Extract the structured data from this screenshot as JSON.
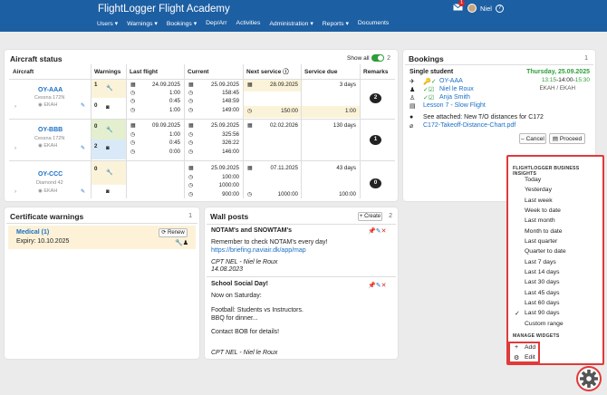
{
  "app": {
    "title": "FlightLogger Flight Academy",
    "notification_count": "1",
    "user": "Niel",
    "help": "?"
  },
  "nav": [
    "Users",
    "Warnings",
    "Bookings",
    "Dep/Arr",
    "Activities",
    "Administration",
    "Reports",
    "Documents"
  ],
  "aircraft": {
    "title": "Aircraft status",
    "show_all_label": "Show all",
    "count": "2",
    "columns": [
      "Aircraft",
      "Warnings",
      "Last flight",
      "Current",
      "Next service",
      "Service due",
      "Remarks"
    ],
    "rows": [
      {
        "reg": "OY-AAA",
        "model": "Cessna 172N",
        "base": "EKAH",
        "w1": "1",
        "w2": "0",
        "last_date": "24.09.2025",
        "last_vals": [
          "1:00",
          "0:45",
          "1:00"
        ],
        "cur_date": "25.09.2025",
        "cur_vals": [
          "158:45",
          "148:59",
          "149:00"
        ],
        "next_date": "28.09.2025",
        "next_val": "150:00",
        "due_days": "3 days",
        "due_val": "1:00",
        "remarks": "2"
      },
      {
        "reg": "OY-BBB",
        "model": "Cessna 172N",
        "base": "EKAH",
        "w1": "0",
        "w2": "2",
        "last_date": "09.09.2025",
        "last_vals": [
          "1:00",
          "0:45",
          "0:00"
        ],
        "cur_date": "25.09.2025",
        "cur_vals": [
          "325:56",
          "326:22",
          "146:00"
        ],
        "next_date": "02.02.2026",
        "next_val": "",
        "due_days": "130 days",
        "due_val": "",
        "remarks": "1"
      },
      {
        "reg": "OY-CCC",
        "model": "Diamond 42",
        "base": "EKAH",
        "w1": "0",
        "w2": "",
        "last_date": "",
        "last_vals": [
          "",
          "",
          ""
        ],
        "cur_date": "25.09.2025",
        "cur_vals": [
          "100:00",
          "1000:00",
          "900:00"
        ],
        "next_date": "07.11.2025",
        "next_val": "1000:00",
        "due_days": "43 days",
        "due_val": "100:00",
        "remarks": "0"
      }
    ]
  },
  "bookings": {
    "title": "Bookings",
    "count": "1",
    "type": "Single student",
    "date": "Thursday, 25.09.2025",
    "time_start": "13:15",
    "time_mid": "14:00",
    "time_end": "15:30",
    "route": "EKAH / EKAH",
    "aircraft": "OY-AAA",
    "instructor": "Niel le Roux",
    "student": "Anja Smith",
    "lesson": "Lesson 7 - Slow Flight",
    "note": "See attached: New T/O distances for C172",
    "attachment": "C172-Takeoff-Distance-Chart.pdf",
    "cancel": "Cancel",
    "proceed": "Proceed"
  },
  "certs": {
    "title": "Certificate warnings",
    "count": "1",
    "item": "Medical (1)",
    "expiry": "Expiry: 10.10.2025",
    "renew": "Renew"
  },
  "wall": {
    "title": "Wall posts",
    "create": "+ Create",
    "count": "2",
    "post1": {
      "title": "NOTAM's and SNOWTAM's",
      "body": "Remember to check NOTAM's every day!",
      "link": "https://briefing.naviair.dk/app/map",
      "author": "CPT NEL - Niel le Roux",
      "date": "14.08.2023"
    },
    "post2": {
      "title": "School Social Day!",
      "l1": "Now on Saturday:",
      "l2": "Football: Students vs Instructors.",
      "l3": "BBQ for dinner...",
      "l4": "Contact BOB for details!",
      "author": "CPT NEL - Niel le Roux"
    }
  },
  "insights": {
    "heading": "FLIGHTLOGGER BUSINESS INSIGHTS",
    "items": [
      "Today",
      "Yesterday",
      "Last week",
      "Week to date",
      "Last month",
      "Month to date",
      "Last quarter",
      "Quarter to date",
      "Last 7 days",
      "Last 14 days",
      "Last 30 days",
      "Last 45 days",
      "Last 60 days",
      "Last 90 days",
      "Custom range"
    ],
    "selected": "Last 90 days",
    "manage": "MANAGE WIDGETS",
    "add": "Add",
    "edit": "Edit"
  },
  "colors": {
    "header": "#1d5fa3",
    "link": "#1a6fc4",
    "highlight": "#e03a3a",
    "green": "#2e9e3a"
  }
}
